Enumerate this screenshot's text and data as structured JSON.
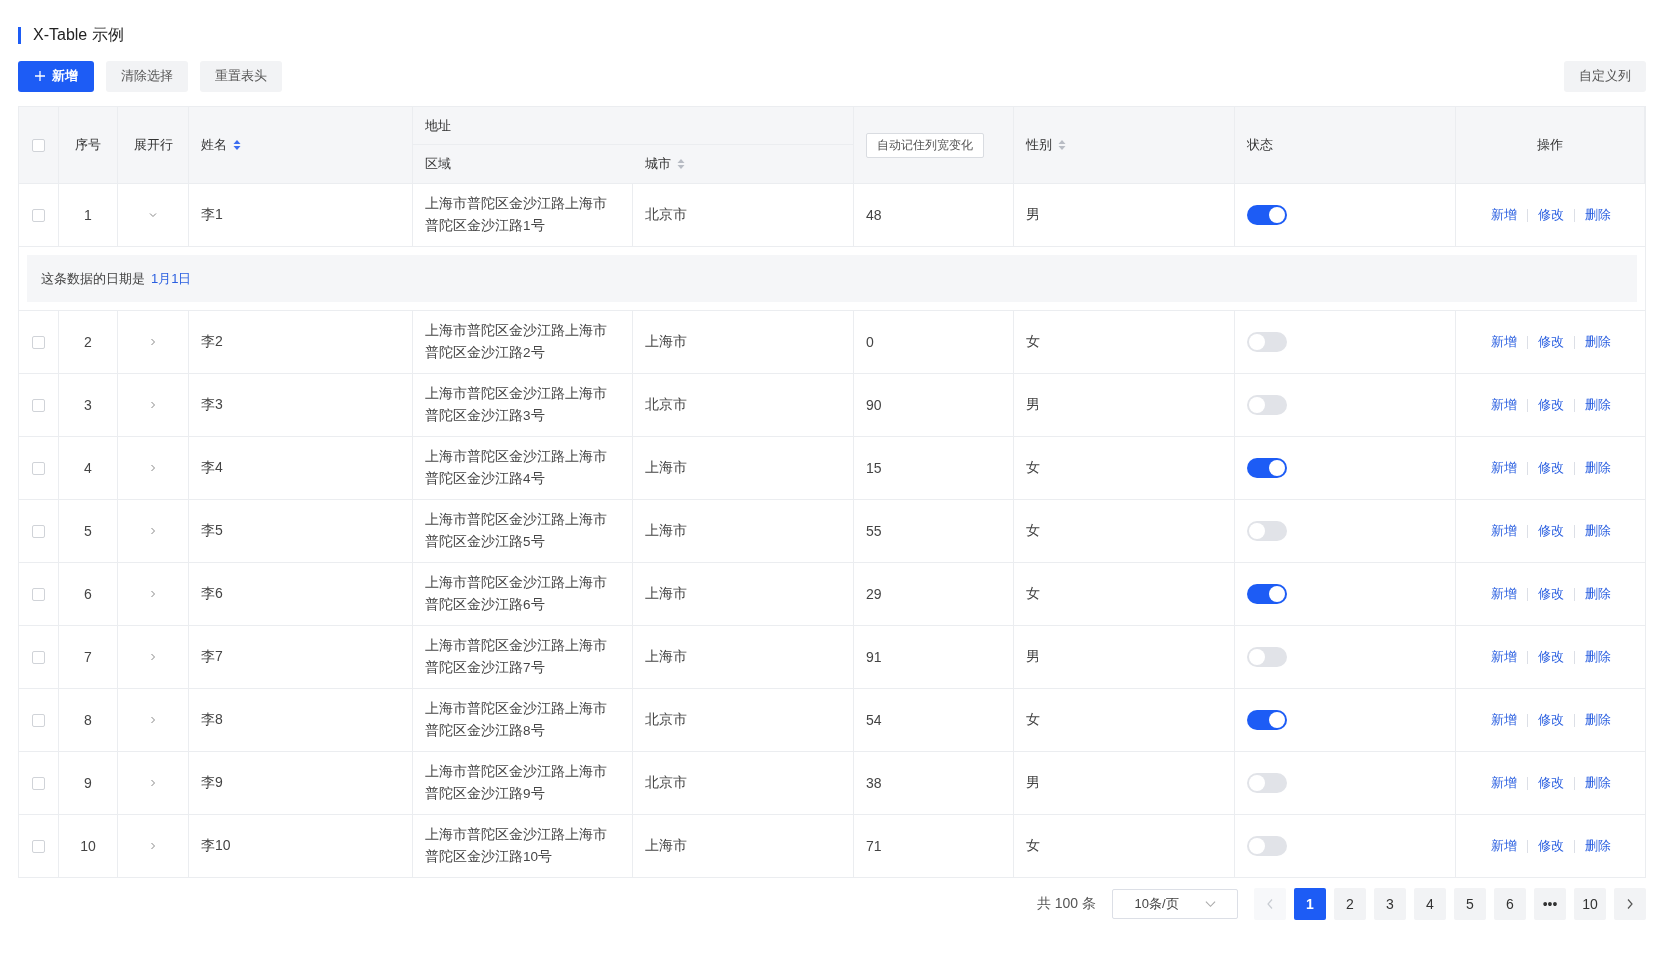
{
  "title": "X-Table 示例",
  "toolbar": {
    "buttons": [
      {
        "label": "新增",
        "kind": "primary"
      },
      {
        "label": "清除选择",
        "kind": "plain"
      },
      {
        "label": "重置表头",
        "kind": "plain"
      }
    ],
    "right_button": "自定义列"
  },
  "table": {
    "select_all_checked": false,
    "columns": {
      "index": "序号",
      "expand": "展开行",
      "name": {
        "label": "姓名",
        "sort_active": true
      },
      "address": "地址",
      "area": "区域",
      "city": {
        "label": "城市",
        "sort_active": false
      },
      "column_6_button": "自动记住列宽变化",
      "gender": {
        "label": "性别",
        "sort_active": false
      },
      "status": "状态",
      "actions": "操作"
    },
    "rows": [
      {
        "checked": false,
        "index": "1",
        "expanded": true,
        "name": "李1",
        "area": "上海市普陀区金沙江路上海市普陀区金沙江路1号",
        "city": "北京市",
        "column_6": "48",
        "gender": "男",
        "on": true,
        "actions": [
          "新增",
          "修改",
          "删除"
        ],
        "detail": {
          "text": "这条数据的日期是",
          "link": "1月1日"
        }
      },
      {
        "checked": false,
        "index": "2",
        "expanded": false,
        "name": "李2",
        "area": "上海市普陀区金沙江路上海市普陀区金沙江路2号",
        "city": "上海市",
        "column_6": "0",
        "gender": "女",
        "on": false,
        "actions": [
          "新增",
          "修改",
          "删除"
        ]
      },
      {
        "checked": false,
        "index": "3",
        "expanded": false,
        "name": "李3",
        "area": "上海市普陀区金沙江路上海市普陀区金沙江路3号",
        "city": "北京市",
        "column_6": "90",
        "gender": "男",
        "on": false,
        "actions": [
          "新增",
          "修改",
          "删除"
        ]
      },
      {
        "checked": false,
        "index": "4",
        "expanded": false,
        "name": "李4",
        "area": "上海市普陀区金沙江路上海市普陀区金沙江路4号",
        "city": "上海市",
        "column_6": "15",
        "gender": "女",
        "on": true,
        "actions": [
          "新增",
          "修改",
          "删除"
        ]
      },
      {
        "checked": false,
        "index": "5",
        "expanded": false,
        "name": "李5",
        "area": "上海市普陀区金沙江路上海市普陀区金沙江路5号",
        "city": "上海市",
        "column_6": "55",
        "gender": "女",
        "on": false,
        "actions": [
          "新增",
          "修改",
          "删除"
        ]
      },
      {
        "checked": false,
        "index": "6",
        "expanded": false,
        "name": "李6",
        "area": "上海市普陀区金沙江路上海市普陀区金沙江路6号",
        "city": "上海市",
        "column_6": "29",
        "gender": "女",
        "on": true,
        "actions": [
          "新增",
          "修改",
          "删除"
        ]
      },
      {
        "checked": false,
        "index": "7",
        "expanded": false,
        "name": "李7",
        "area": "上海市普陀区金沙江路上海市普陀区金沙江路7号",
        "city": "上海市",
        "column_6": "91",
        "gender": "男",
        "on": false,
        "actions": [
          "新增",
          "修改",
          "删除"
        ]
      },
      {
        "checked": false,
        "index": "8",
        "expanded": false,
        "name": "李8",
        "area": "上海市普陀区金沙江路上海市普陀区金沙江路8号",
        "city": "北京市",
        "column_6": "54",
        "gender": "女",
        "on": true,
        "actions": [
          "新增",
          "修改",
          "删除"
        ]
      },
      {
        "checked": false,
        "index": "9",
        "expanded": false,
        "name": "李9",
        "area": "上海市普陀区金沙江路上海市普陀区金沙江路9号",
        "city": "北京市",
        "column_6": "38",
        "gender": "男",
        "on": false,
        "actions": [
          "新增",
          "修改",
          "删除"
        ]
      },
      {
        "checked": false,
        "index": "10",
        "expanded": false,
        "name": "李10",
        "area": "上海市普陀区金沙江路上海市普陀区金沙江路10号",
        "city": "上海市",
        "column_6": "71",
        "gender": "女",
        "on": false,
        "actions": [
          "新增",
          "修改",
          "删除"
        ]
      }
    ]
  },
  "pagination": {
    "total": "共 100 条",
    "page_size": "10条/页",
    "prev_disabled": true,
    "next_disabled": false,
    "pages": [
      {
        "label": "1",
        "selected": true
      },
      {
        "label": "2",
        "selected": false
      },
      {
        "label": "3",
        "selected": false
      },
      {
        "label": "4",
        "selected": false
      },
      {
        "label": "5",
        "selected": false
      },
      {
        "label": "6",
        "selected": false
      },
      {
        "label": "•••",
        "selected": false
      },
      {
        "label": "10",
        "selected": false
      }
    ]
  }
}
